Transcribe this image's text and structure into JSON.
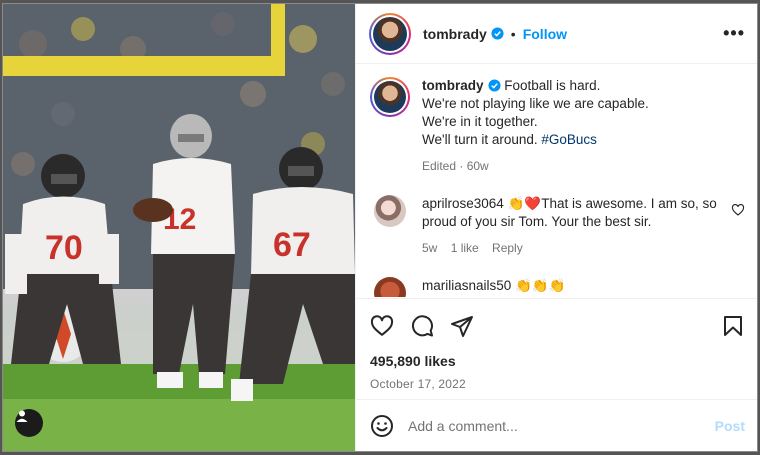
{
  "post": {
    "username": "tombrady",
    "follow_label": "Follow",
    "separator": "•",
    "more_label": "•••",
    "caption_lines": [
      "Football is hard.",
      "We're not playing like we are capable.",
      "We're in it together.",
      "We'll turn it around."
    ],
    "hashtag": "#GoBucs",
    "caption_meta": "Edited · 60w",
    "likes": "495,890 likes",
    "date": "October 17, 2022"
  },
  "comments": [
    {
      "username": "aprilrose3064",
      "emoji": "👏❤️",
      "text": "That is awesome. I am so, so proud of you sir Tom. Your the best sir.",
      "age": "5w",
      "likes": "1 like",
      "reply": "Reply"
    },
    {
      "username": "mariliasnails50",
      "emoji": "👏👏👏"
    }
  ],
  "composer": {
    "placeholder": "Add a comment...",
    "post_label": "Post"
  },
  "icons": {
    "like": "heart-icon",
    "comment": "comment-icon",
    "share": "share-icon",
    "save": "bookmark-icon",
    "emoji": "emoji-icon",
    "user_tag": "user-icon",
    "verified": "verified-badge-icon"
  },
  "colors": {
    "accent": "#0095f6",
    "hashtag": "#00376b",
    "muted": "#737373",
    "post_disabled": "#b3dbff"
  }
}
